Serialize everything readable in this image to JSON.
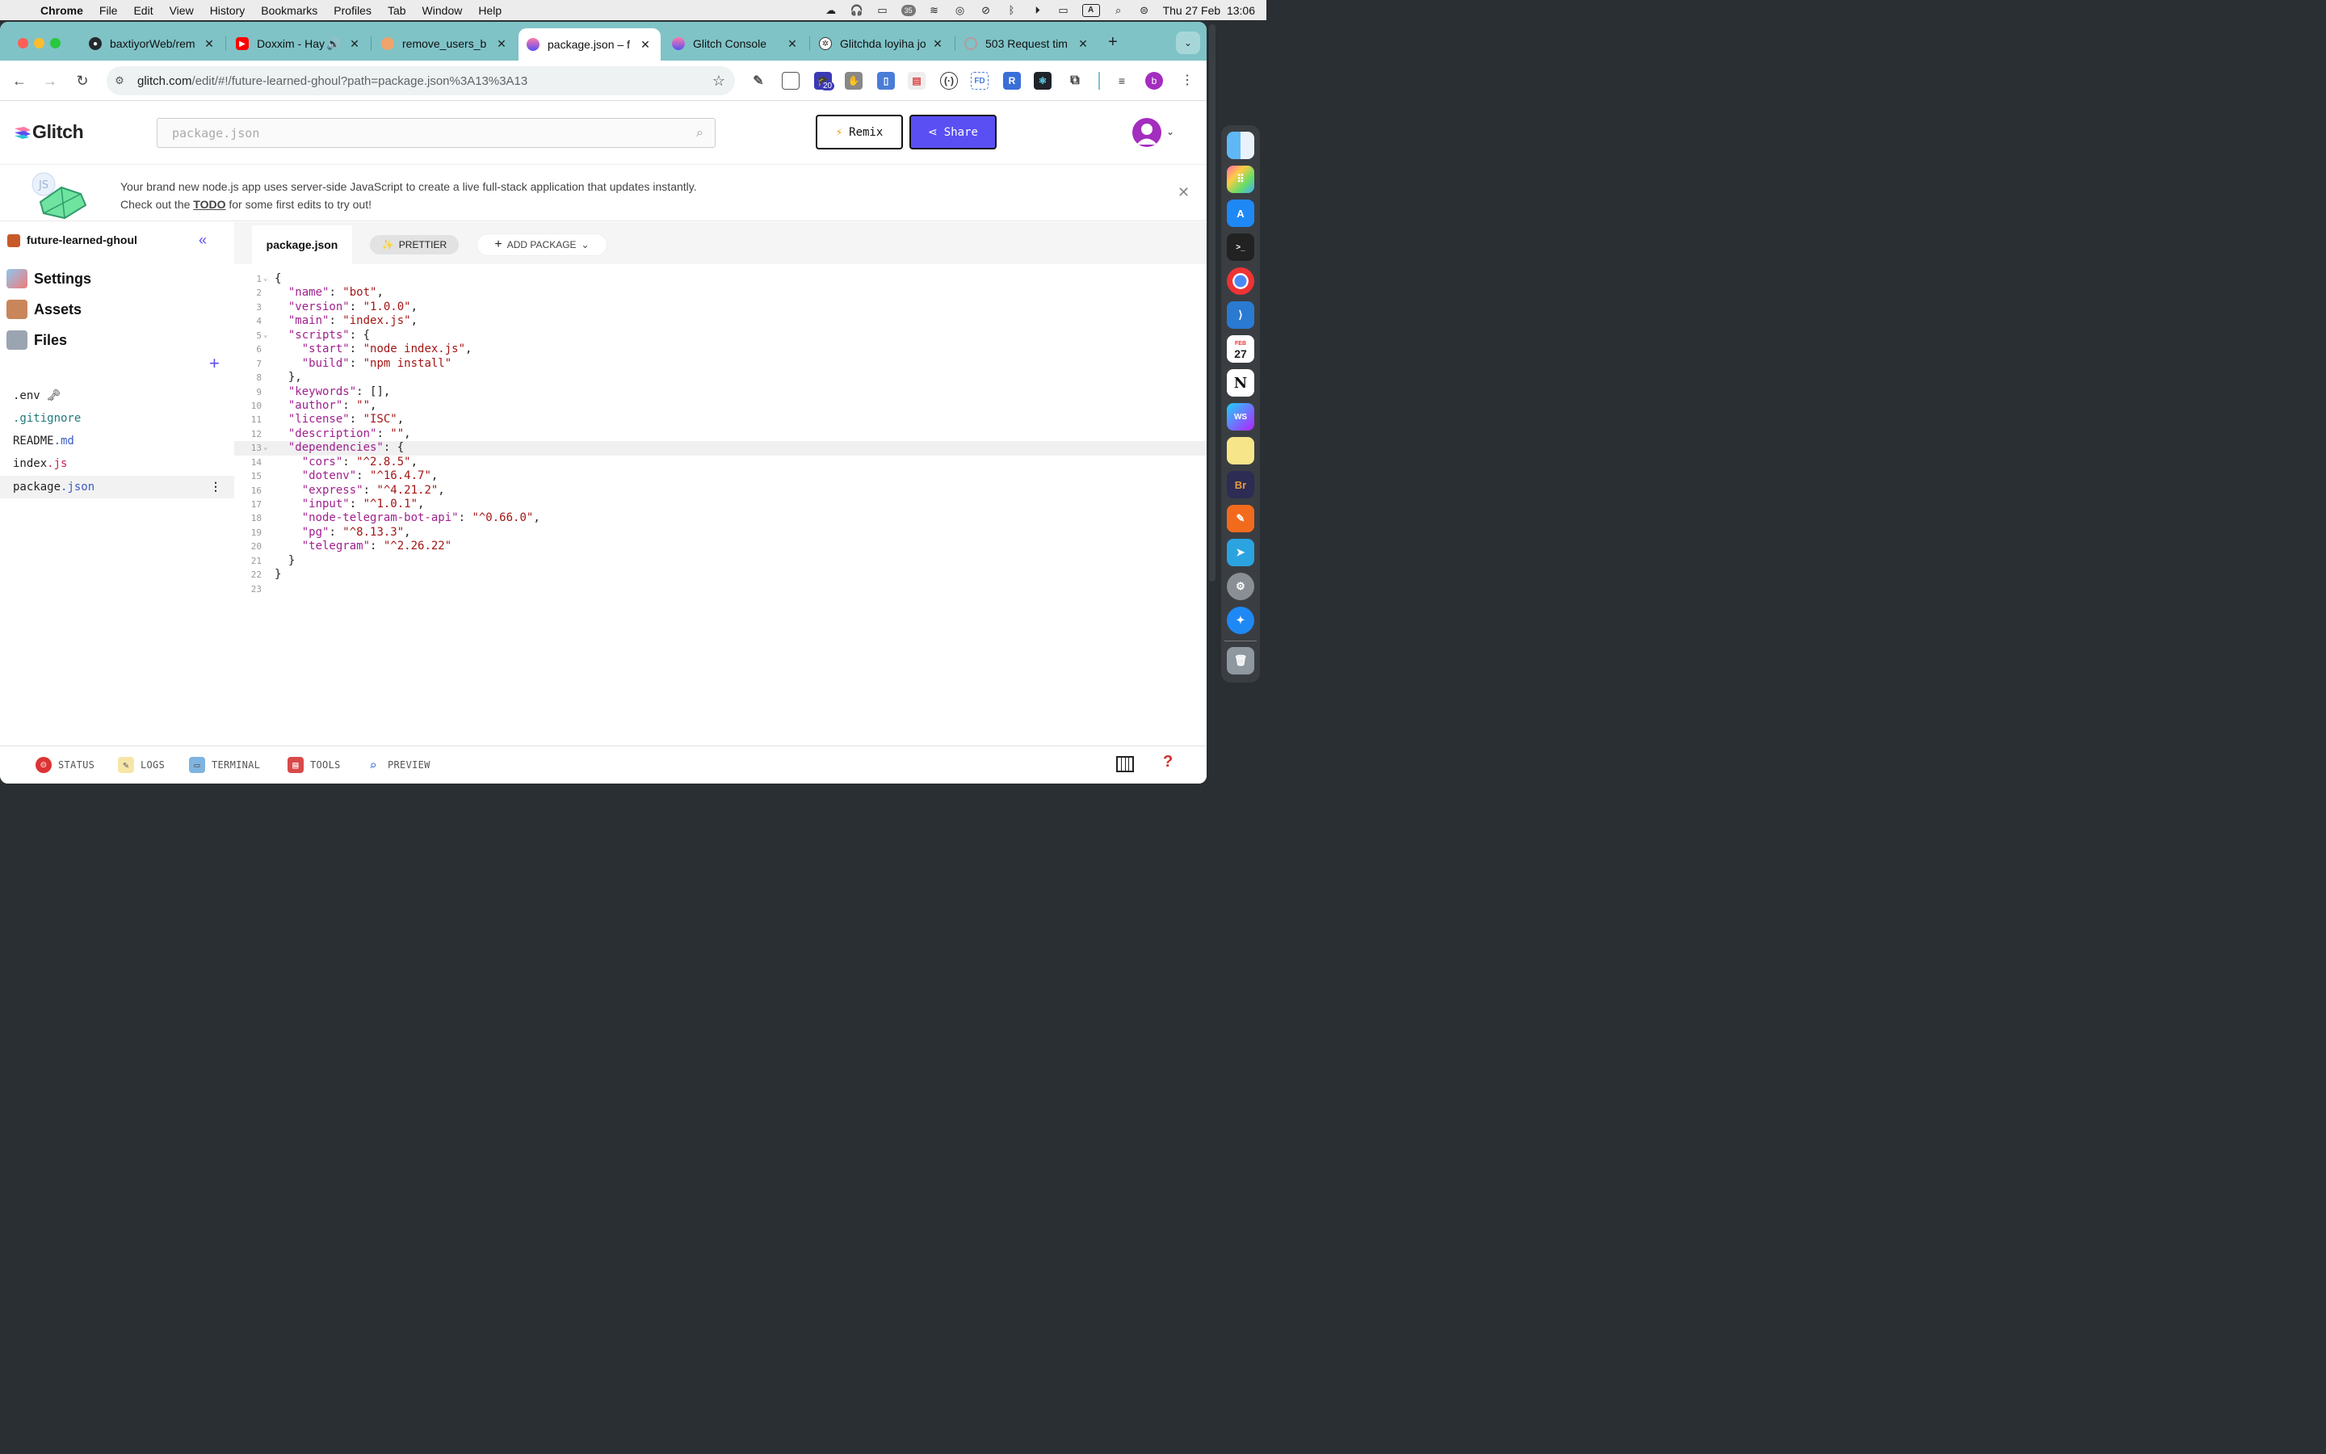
{
  "menubar": {
    "app": "Chrome",
    "items": [
      "File",
      "Edit",
      "View",
      "History",
      "Bookmarks",
      "Profiles",
      "Tab",
      "Window",
      "Help"
    ],
    "clock": "Thu 27 Feb  13:06",
    "input_source": "A",
    "badge": "35"
  },
  "tabs": [
    {
      "title": "baxtiyorWeb/rem",
      "icon": "github-icon",
      "color": "#24292f"
    },
    {
      "title": "Doxxim - Hay",
      "icon": "youtube-icon",
      "color": "#ff0000"
    },
    {
      "title": "remove_users_b",
      "icon": "glitch-icon",
      "color": "#f0a36b"
    },
    {
      "title": "package.json – f",
      "icon": "glitch-icon",
      "color": "#5a4ff3"
    },
    {
      "title": "Glitch Console",
      "icon": "glitch-icon",
      "color": "#5a4ff3"
    },
    {
      "title": "Glitchda loyiha jo",
      "icon": "chatgpt-icon",
      "color": "#333333"
    },
    {
      "title": "503 Request tim",
      "icon": "loading-icon",
      "color": "#c7a0a0"
    }
  ],
  "url": {
    "host": "glitch.com",
    "path": "/edit/#!/future-learned-ghoul?path=package.json%3A13%3A13"
  },
  "extensions_badge": "20",
  "profile_initial": "b",
  "glitch": {
    "logo": "Glitch",
    "search_placeholder": "package.json",
    "remix_label": "Remix",
    "share_label": "Share",
    "notice_part1": "Your brand new node.js app uses server-side JavaScript to create a live full-stack application that updates instantly. Check out the ",
    "notice_link": "TODO",
    "notice_part2": " for some first edits to try out!"
  },
  "sidebar": {
    "project": "future-learned-ghoul",
    "sections": [
      "Settings",
      "Assets",
      "Files"
    ],
    "files": [
      {
        "name": ".env",
        "ext": "",
        "extra": "🗝"
      },
      {
        "name": ".gitignore",
        "ext": "",
        "extra": ""
      },
      {
        "name": "README",
        "ext": ".md",
        "extra": ""
      },
      {
        "name": "index",
        "ext": ".js",
        "extra": ""
      },
      {
        "name": "package",
        "ext": ".json",
        "extra": ""
      }
    ]
  },
  "editor": {
    "tab": "package.json",
    "prettier": "PRETTIER",
    "add_package": "ADD PACKAGE",
    "highlight_line": 13,
    "lines": [
      "{",
      "  \"name\": \"bot\",",
      "  \"version\": \"1.0.0\",",
      "  \"main\": \"index.js\",",
      "  \"scripts\": {",
      "    \"start\": \"node index.js\",",
      "    \"build\": \"npm install\"",
      "  },",
      "  \"keywords\": [],",
      "  \"author\": \"\",",
      "  \"license\": \"ISC\",",
      "  \"description\": \"\",",
      "  \"dependencies\": {",
      "    \"cors\": \"^2.8.5\",",
      "    \"dotenv\": \"^16.4.7\",",
      "    \"express\": \"^4.21.2\",",
      "    \"input\": \"^1.0.1\",",
      "    \"node-telegram-bot-api\": \"^0.66.0\",",
      "    \"pg\": \"^8.13.3\",",
      "    \"telegram\": \"^2.26.22\"",
      "  }",
      "}",
      ""
    ],
    "foldable": [
      1,
      5,
      13
    ]
  },
  "bottombar": {
    "status": "STATUS",
    "logs": "LOGS",
    "terminal": "TERMINAL",
    "tools": "TOOLS",
    "preview": "PREVIEW",
    "help": "?"
  },
  "dock": {
    "calendar_month": "FEB",
    "calendar_day": "27"
  }
}
